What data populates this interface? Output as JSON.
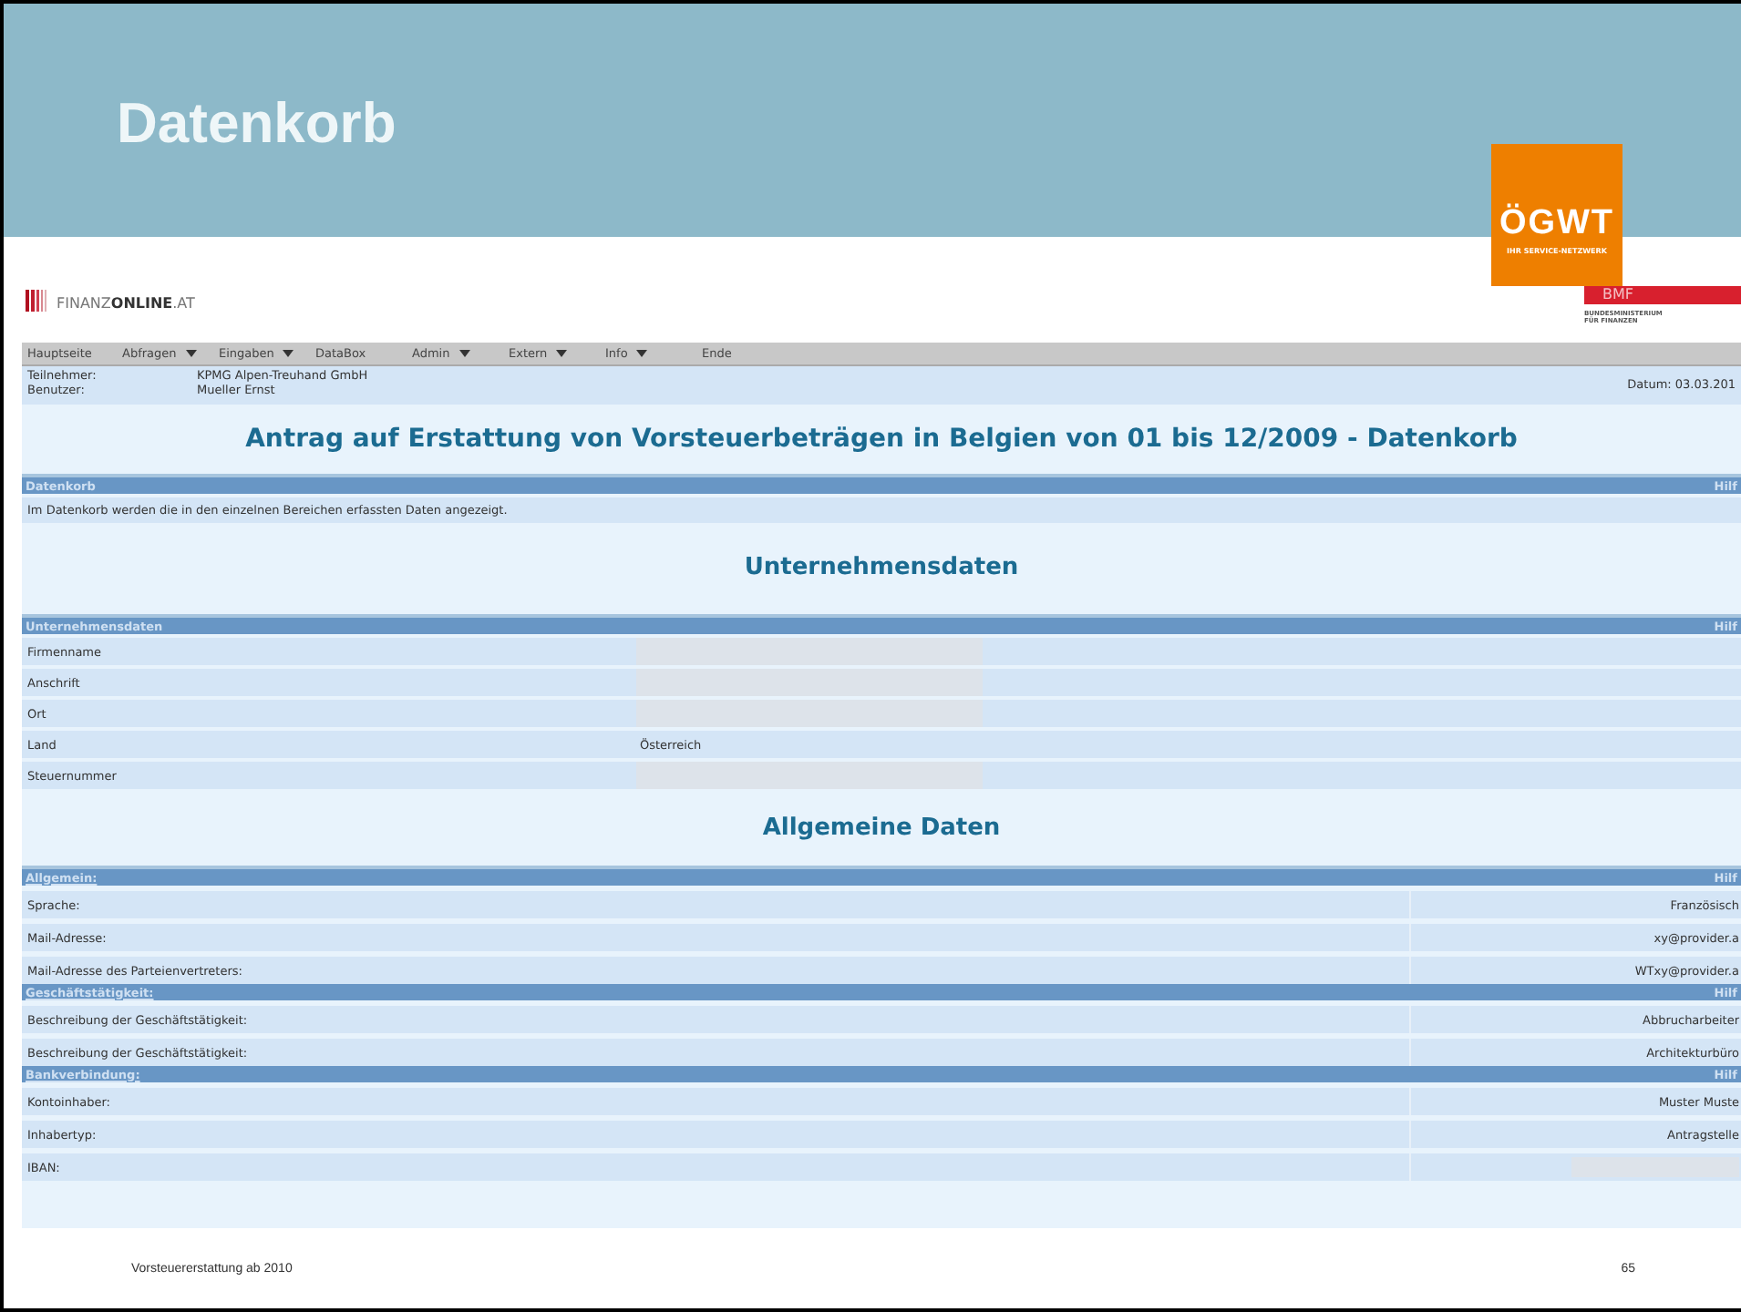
{
  "slide": {
    "title": "Datenkorb",
    "footer_left": "Vorsteuererstattung ab 2010",
    "page_number": "65"
  },
  "logo": {
    "name": "ÖGWT",
    "tagline": "IHR SERVICE-NETZWERK"
  },
  "portal": {
    "brand_light": "FINANZ",
    "brand_bold": "ONLINE",
    "brand_suffix": ".AT",
    "ministry_short": "BMF",
    "ministry_line1": "BUNDESMINISTERIUM",
    "ministry_line2": "FÜR FINANZEN"
  },
  "menu": [
    {
      "label": "Hauptseite",
      "has_menu": false
    },
    {
      "label": "Abfragen",
      "has_menu": true
    },
    {
      "label": "Eingaben",
      "has_menu": true
    },
    {
      "label": "DataBox",
      "has_menu": false
    },
    {
      "label": "Admin",
      "has_menu": true
    },
    {
      "label": "Extern",
      "has_menu": true
    },
    {
      "label": "Info",
      "has_menu": true
    },
    {
      "label": "Ende",
      "has_menu": false
    }
  ],
  "user_info": [
    {
      "label": "Teilnehmer:",
      "value": "KPMG Alpen-Treuhand GmbH"
    },
    {
      "label": "Benutzer:",
      "value": "Mueller Ernst"
    }
  ],
  "date": "Datum: 03.03.201",
  "page_title": "Antrag auf Erstattung von Vorsteuerbeträgen in Belgien von 01 bis 12/2009 - Datenkorb",
  "intro": {
    "bar": "Datenkorb",
    "help": "Hilf",
    "text": "Im Datenkorb werden die in den einzelnen Bereichen erfassten Daten angezeigt."
  },
  "sections": [
    {
      "heading": "Unternehmensdaten",
      "kind": "split",
      "groups": [
        {
          "bar": "Unternehmensdaten",
          "link": false,
          "help": "Hilf",
          "rows": [
            {
              "label": "Firmenname",
              "kind": "blank"
            },
            {
              "label": "Anschrift",
              "kind": "blank"
            },
            {
              "label": "Ort",
              "kind": "blank"
            },
            {
              "label": "Land",
              "kind": "text",
              "value": "Österreich"
            },
            {
              "label": "Steuernummer",
              "kind": "blank"
            }
          ]
        }
      ]
    },
    {
      "heading": "Allgemeine Daten",
      "kind": "aligned",
      "groups": [
        {
          "bar": "Allgemein:",
          "link": true,
          "help": "Hilf",
          "rows": [
            {
              "label": "Sprache:",
              "kind": "text",
              "value": "Französisch"
            },
            {
              "label": "Mail-Adresse:",
              "kind": "text",
              "value": "xy@provider.a"
            },
            {
              "label": "Mail-Adresse des Parteienvertreters:",
              "kind": "text",
              "value": "WTxy@provider.a"
            }
          ]
        },
        {
          "bar": "Geschäftstätigkeit:",
          "link": true,
          "help": "Hilf",
          "rows": [
            {
              "label": "Beschreibung der Geschäftstätigkeit:",
              "kind": "text",
              "value": "Abbrucharbeiter"
            },
            {
              "label": "Beschreibung der Geschäftstätigkeit:",
              "kind": "text",
              "value": "Architekturbüro"
            }
          ]
        },
        {
          "bar": "Bankverbindung:",
          "link": true,
          "help": "Hilf",
          "rows": [
            {
              "label": "Kontoinhaber:",
              "kind": "text",
              "value": "Muster Muste"
            },
            {
              "label": "Inhabertyp:",
              "kind": "text",
              "value": "Antragstelle"
            },
            {
              "label": "IBAN:",
              "kind": "blank"
            }
          ]
        }
      ]
    }
  ]
}
